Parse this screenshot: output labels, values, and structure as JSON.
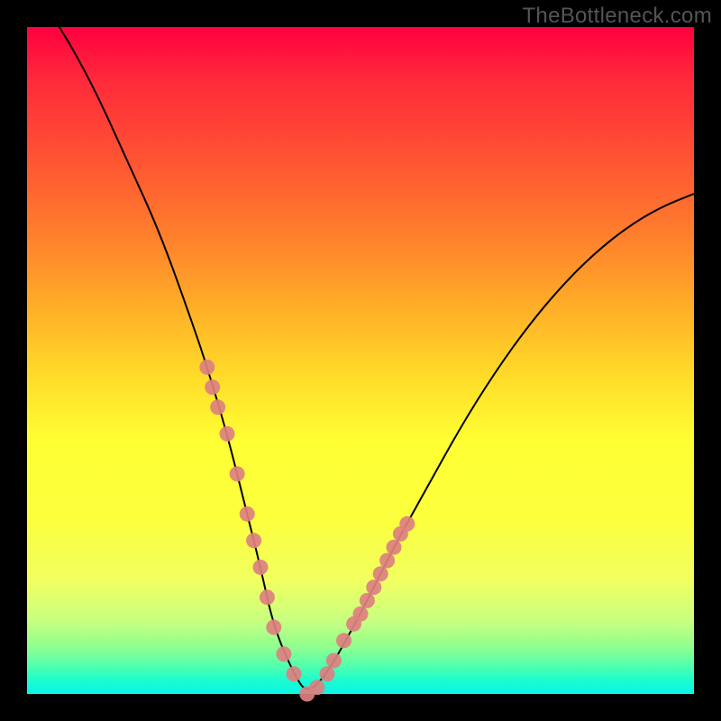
{
  "watermark": "TheBottleneck.com",
  "colors": {
    "background": "#000000",
    "curve_stroke": "#000000",
    "marker_fill": "#dd8080",
    "gradient_top": "#ff0040",
    "gradient_bottom": "#0af5e8"
  },
  "chart_data": {
    "type": "line",
    "title": "",
    "xlabel": "",
    "ylabel": "",
    "xlim": [
      0,
      100
    ],
    "ylim": [
      0,
      100
    ],
    "annotations": [
      "TheBottleneck.com"
    ],
    "series": [
      {
        "name": "bottleneck-curve",
        "x": [
          0,
          5,
          10,
          15,
          20,
          25,
          27,
          30,
          33,
          35,
          37,
          40,
          42,
          45,
          50,
          55,
          60,
          65,
          70,
          75,
          80,
          85,
          90,
          95,
          100
        ],
        "y": [
          107,
          100,
          91,
          80,
          69,
          55,
          49,
          39,
          27,
          19,
          10,
          3,
          0,
          3,
          12,
          22,
          31,
          40,
          48,
          55,
          61,
          66,
          70,
          73,
          75
        ]
      }
    ],
    "markers": {
      "name": "highlight-segments",
      "x": [
        27.0,
        27.8,
        28.6,
        30.0,
        31.5,
        33.0,
        34.0,
        35.0,
        36.0,
        37.0,
        38.5,
        40.0,
        42.0,
        43.5,
        45.0,
        46.0,
        47.5,
        49.0,
        50.0,
        51.0,
        52.0,
        53.0,
        54.0,
        55.0,
        56.0,
        57.0
      ],
      "y": [
        49.0,
        46.0,
        43.0,
        39.0,
        33.0,
        27.0,
        23.0,
        19.0,
        14.5,
        10.0,
        6.0,
        3.0,
        0.0,
        1.0,
        3.0,
        5.0,
        8.0,
        10.5,
        12.0,
        14.0,
        16.0,
        18.0,
        20.0,
        22.0,
        24.0,
        25.5
      ]
    }
  }
}
